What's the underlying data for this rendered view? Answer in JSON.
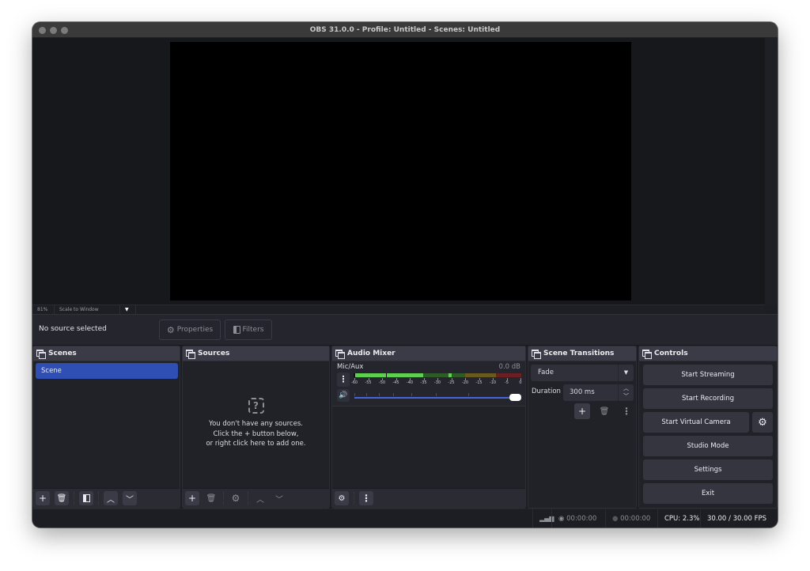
{
  "window": {
    "title": "OBS 31.0.0 - Profile: Untitled - Scenes: Untitled"
  },
  "preview": {
    "zoom": "81%",
    "scale_mode": "Scale to Window"
  },
  "context_bar": {
    "no_source": "No source selected",
    "properties_label": "Properties",
    "filters_label": "Filters"
  },
  "scenes": {
    "title": "Scenes",
    "items": [
      {
        "label": "Scene",
        "selected": true
      }
    ]
  },
  "sources": {
    "title": "Sources",
    "empty_line1": "You don't have any sources.",
    "empty_line2": "Click the + button below,",
    "empty_line3": "or right click here to add one."
  },
  "audio_mixer": {
    "title": "Audio Mixer",
    "channels": [
      {
        "name": "Mic/Aux",
        "level": "0.0 dB",
        "volume_fraction": 1.0
      }
    ],
    "meter_ticks": [
      "-60",
      "-55",
      "-50",
      "-45",
      "-40",
      "-35",
      "-30",
      "-25",
      "-20",
      "-15",
      "-10",
      "-5",
      "0"
    ],
    "meter_colors": {
      "green": "#5fcf4f",
      "green_dark": "#2e5b28",
      "yellow": "#6b5a1f",
      "red": "#6b1f22"
    }
  },
  "scene_transitions": {
    "title": "Scene Transitions",
    "transition": "Fade",
    "duration_label": "Duration",
    "duration_value": "300 ms"
  },
  "controls": {
    "title": "Controls",
    "buttons": [
      "Start Streaming",
      "Start Recording",
      "Start Virtual Camera",
      "Studio Mode",
      "Settings",
      "Exit"
    ]
  },
  "status_bar": {
    "stream_time": "00:00:00",
    "record_time": "00:00:00",
    "cpu": "CPU: 2.3%",
    "fps": "30.00 / 30.00 FPS"
  },
  "colors": {
    "accent": "#2f4fb5",
    "volume": "#4565d8"
  }
}
